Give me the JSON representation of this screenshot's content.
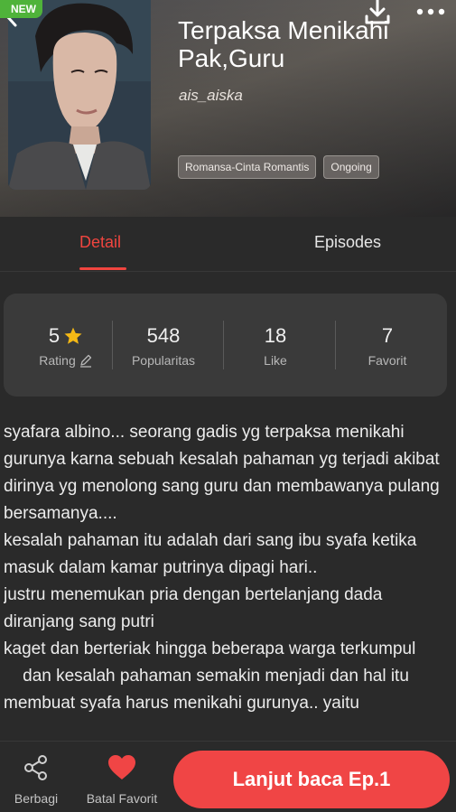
{
  "header": {
    "badge": "NEW",
    "title": "Terpaksa Menikahi Pak,Guru",
    "author": "ais_aiska",
    "tags": [
      "Romansa-Cinta Romantis",
      "Ongoing"
    ],
    "icons": {
      "back": "back-arrow-icon",
      "download": "download-icon",
      "more": "more-dots-icon"
    }
  },
  "tabs": {
    "detail": "Detail",
    "episodes": "Episodes",
    "active": "detail"
  },
  "stats": {
    "rating": {
      "value": "5",
      "label": "Rating"
    },
    "popularity": {
      "value": "548",
      "label": "Popularitas"
    },
    "like": {
      "value": "18",
      "label": "Like"
    },
    "favorite": {
      "value": "7",
      "label": "Favorit"
    }
  },
  "description": "syafara albino... seorang gadis yg terpaksa menikahi gurunya karna sebuah kesalah pahaman yg terjadi akibat dirinya yg menolong sang guru dan membawanya pulang bersamanya....\nkesalah pahaman itu adalah dari sang ibu syafa ketika masuk dalam kamar putrinya dipagi hari..\njustru menemukan pria dengan bertelanjang dada diranjang sang putri\nkaget dan berteriak hingga beberapa warga terkumpul\n    dan kesalah pahaman semakin menjadi dan hal itu membuat syafa harus menikahi gurunya.. yaitu",
  "bottom": {
    "share_label": "Berbagi",
    "favorite_label": "Batal Favorit",
    "read_label": "Lanjut baca Ep.1"
  },
  "colors": {
    "accent": "#f04545",
    "badge": "#4fb33a",
    "star": "#f5b915"
  }
}
